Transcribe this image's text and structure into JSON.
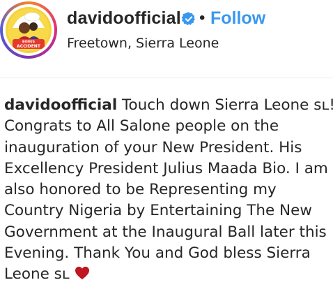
{
  "post_header": {
    "username": "davidoofficial",
    "separator": "•",
    "follow_label": "Follow",
    "location": "Freetown, Sierra Leone",
    "verified_icon": "verified-badge-icon",
    "avatar_text": "BONUS ACCIDENT"
  },
  "caption": {
    "username": "davidoofficial",
    "lines": [
      "Touch down Sierra Leone ꜱʟ!!",
      "Congrats to All Salone people on the",
      "inauguration of your New President. His",
      "Excellency President Julius Maada Bio. I am",
      "also honored to be Representing my",
      "Country Nigeria by Entertaining The New",
      "Government at the Inaugural Ball later this",
      "Evening. Thank You and God bless Sierra",
      "Leone ꜱʟ"
    ],
    "heart_icon": "red-heart-icon"
  },
  "colors": {
    "follow": "#3897f0",
    "text": "#262626",
    "heart": "#c0161f"
  }
}
